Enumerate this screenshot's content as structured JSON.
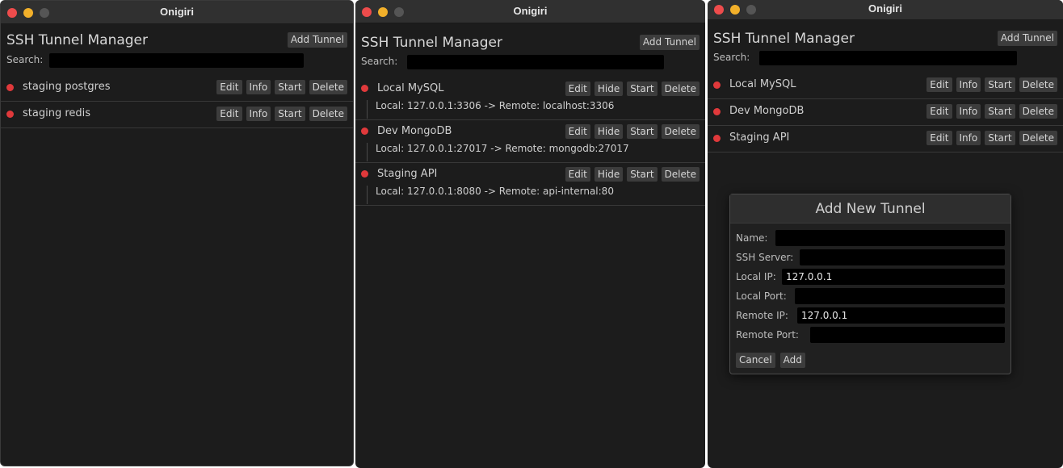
{
  "app_title": "Onigiri",
  "manager_title": "SSH Tunnel Manager",
  "add_tunnel_label": "Add Tunnel",
  "search_label": "Search:",
  "search_value": "",
  "actions": {
    "edit": "Edit",
    "info": "Info",
    "hide": "Hide",
    "start": "Start",
    "delete": "Delete"
  },
  "windows": [
    {
      "tunnels": [
        {
          "name": "staging postgres",
          "status": "stopped"
        },
        {
          "name": "staging redis",
          "status": "stopped"
        }
      ]
    },
    {
      "tunnels": [
        {
          "name": "Local MySQL",
          "status": "stopped",
          "detail": "Local: 127.0.0.1:3306 -> Remote: localhost:3306"
        },
        {
          "name": "Dev MongoDB",
          "status": "stopped",
          "detail": "Local: 127.0.0.1:27017 -> Remote: mongodb:27017"
        },
        {
          "name": "Staging API",
          "status": "stopped",
          "detail": "Local: 127.0.0.1:8080 -> Remote: api-internal:80"
        }
      ]
    },
    {
      "tunnels": [
        {
          "name": "Local MySQL",
          "status": "stopped"
        },
        {
          "name": "Dev MongoDB",
          "status": "stopped"
        },
        {
          "name": "Staging API",
          "status": "stopped"
        }
      ],
      "dialog": {
        "title": "Add New Tunnel",
        "fields": [
          {
            "label": "Name:",
            "value": ""
          },
          {
            "label": "SSH Server:",
            "value": ""
          },
          {
            "label": "Local IP:",
            "value": "127.0.0.1"
          },
          {
            "label": "Local Port:",
            "value": ""
          },
          {
            "label": "Remote IP:",
            "value": "127.0.0.1"
          },
          {
            "label": "Remote Port:",
            "value": ""
          }
        ],
        "cancel_label": "Cancel",
        "add_label": "Add"
      }
    }
  ],
  "colors": {
    "status_stopped": "#e0393b",
    "close": "#ee4c4c",
    "minimize": "#f2b02a",
    "maximize_disabled": "#555555",
    "background": "#1c1c1c"
  }
}
